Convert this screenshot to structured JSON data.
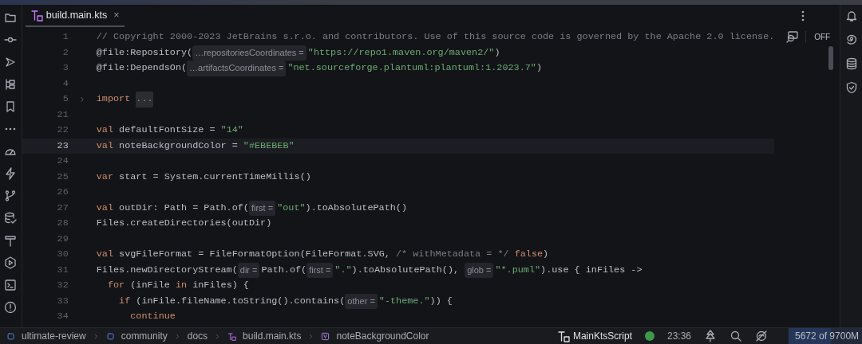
{
  "tab": {
    "title": "build.main.kts",
    "close": "×",
    "selected": true
  },
  "editor": {
    "reader_mode": "OFF",
    "lines": [
      {
        "number": "1",
        "current": false,
        "tokens": [
          {
            "kind": "comment",
            "text": "// Copyright 2000-2023 JetBrains s.r.o. and contributors. Use of this source code is governed by the Apache 2.0 license."
          }
        ]
      },
      {
        "number": "2",
        "current": false,
        "tokens": [
          {
            "kind": "plain",
            "text": "@file:Repository("
          },
          {
            "kind": "hint",
            "text": "…repositoriesCoordinates ="
          },
          {
            "kind": "str",
            "text": "\"https://repo1.maven.org/maven2/\""
          },
          {
            "kind": "plain",
            "text": ")"
          }
        ]
      },
      {
        "number": "3",
        "current": false,
        "tokens": [
          {
            "kind": "plain",
            "text": "@file:DependsOn("
          },
          {
            "kind": "hint",
            "text": "…artifactsCoordinates ="
          },
          {
            "kind": "str",
            "text": "\"net.sourceforge.plantuml:plantuml:1.2023.7\""
          },
          {
            "kind": "plain",
            "text": ")"
          }
        ]
      },
      {
        "number": "4",
        "current": false
      },
      {
        "number": "5",
        "current": false,
        "folded": true,
        "tokens": [
          {
            "kind": "kw",
            "text": "import "
          },
          {
            "kind": "fold",
            "text": "..."
          }
        ]
      },
      {
        "number": "21",
        "current": false
      },
      {
        "number": "22",
        "current": false,
        "tokens": [
          {
            "kind": "kw",
            "text": "val"
          },
          {
            "kind": "plain",
            "text": " defaultFontSize = "
          },
          {
            "kind": "str",
            "text": "\"14\""
          }
        ]
      },
      {
        "number": "23",
        "current": true,
        "tokens": [
          {
            "kind": "kw",
            "text": "val"
          },
          {
            "kind": "plain",
            "text": " noteBackgroundColor = "
          },
          {
            "kind": "str",
            "text": "\"#EBEBEB\""
          }
        ]
      },
      {
        "number": "24",
        "current": false
      },
      {
        "number": "25",
        "current": false,
        "tokens": [
          {
            "kind": "kw",
            "text": "var"
          },
          {
            "kind": "plain",
            "text": " start = System.currentTimeMillis()"
          }
        ]
      },
      {
        "number": "26",
        "current": false
      },
      {
        "number": "27",
        "current": false,
        "tokens": [
          {
            "kind": "kw",
            "text": "val"
          },
          {
            "kind": "plain",
            "text": " outDir: Path = Path.of("
          },
          {
            "kind": "hint",
            "text": "first ="
          },
          {
            "kind": "str",
            "text": "\"out\""
          },
          {
            "kind": "plain",
            "text": ").toAbsolutePath()"
          }
        ]
      },
      {
        "number": "28",
        "current": false,
        "tokens": [
          {
            "kind": "plain",
            "text": "Files.createDirectories(outDir)"
          }
        ]
      },
      {
        "number": "29",
        "current": false
      },
      {
        "number": "30",
        "current": false,
        "tokens": [
          {
            "kind": "kw",
            "text": "val"
          },
          {
            "kind": "plain",
            "text": " svgFileFormat = FileFormatOption(FileFormat.SVG, "
          },
          {
            "kind": "comment",
            "text": "/* withMetadata = */ "
          },
          {
            "kind": "kw",
            "text": "false"
          },
          {
            "kind": "plain",
            "text": ")"
          }
        ]
      },
      {
        "number": "31",
        "current": false,
        "tokens": [
          {
            "kind": "plain",
            "text": "Files.newDirectoryStream("
          },
          {
            "kind": "hint",
            "text": "dir ="
          },
          {
            "kind": "plain",
            "text": "Path.of("
          },
          {
            "kind": "hint",
            "text": "first ="
          },
          {
            "kind": "str",
            "text": "\".\""
          },
          {
            "kind": "plain",
            "text": ").toAbsolutePath(), "
          },
          {
            "kind": "hint",
            "text": "glob ="
          },
          {
            "kind": "str",
            "text": "\"*.puml\""
          },
          {
            "kind": "plain",
            "text": ").use { inFiles ->"
          }
        ],
        "children": [
          {
            "number": "32",
            "current": false,
            "tokens": [
              {
                "kind": "kw",
                "text": "for"
              },
              {
                "kind": "plain",
                "text": " (inFile "
              },
              {
                "kind": "kw",
                "text": "in"
              },
              {
                "kind": "plain",
                "text": " inFiles) {"
              }
            ],
            "children": [
              {
                "number": "33",
                "current": false,
                "tokens": [
                  {
                    "kind": "kw",
                    "text": "if"
                  },
                  {
                    "kind": "plain",
                    "text": " (inFile.fileName.toString().contains("
                  },
                  {
                    "kind": "hint",
                    "text": "other ="
                  },
                  {
                    "kind": "str",
                    "text": "\"-theme.\""
                  },
                  {
                    "kind": "plain",
                    "text": ")) {"
                  }
                ],
                "children": [
                  {
                    "number": "34",
                    "current": false,
                    "tokens": [
                      {
                        "kind": "kw",
                        "text": "continue"
                      }
                    ]
                  }
                ]
              }
            ]
          }
        ]
      }
    ]
  },
  "breadcrumbs": [
    {
      "kind": "module",
      "text": "ultimate-review"
    },
    {
      "kind": "module",
      "text": "community"
    },
    {
      "kind": "folder",
      "text": "docs"
    },
    {
      "kind": "script",
      "text": "build.main.kts"
    },
    {
      "kind": "property",
      "text": "noteBackgroundColor"
    }
  ],
  "status": {
    "config": "MainKtsScript",
    "caret": "23:36",
    "memory": {
      "text": "5672 of 9700M",
      "level": 0.58
    }
  }
}
